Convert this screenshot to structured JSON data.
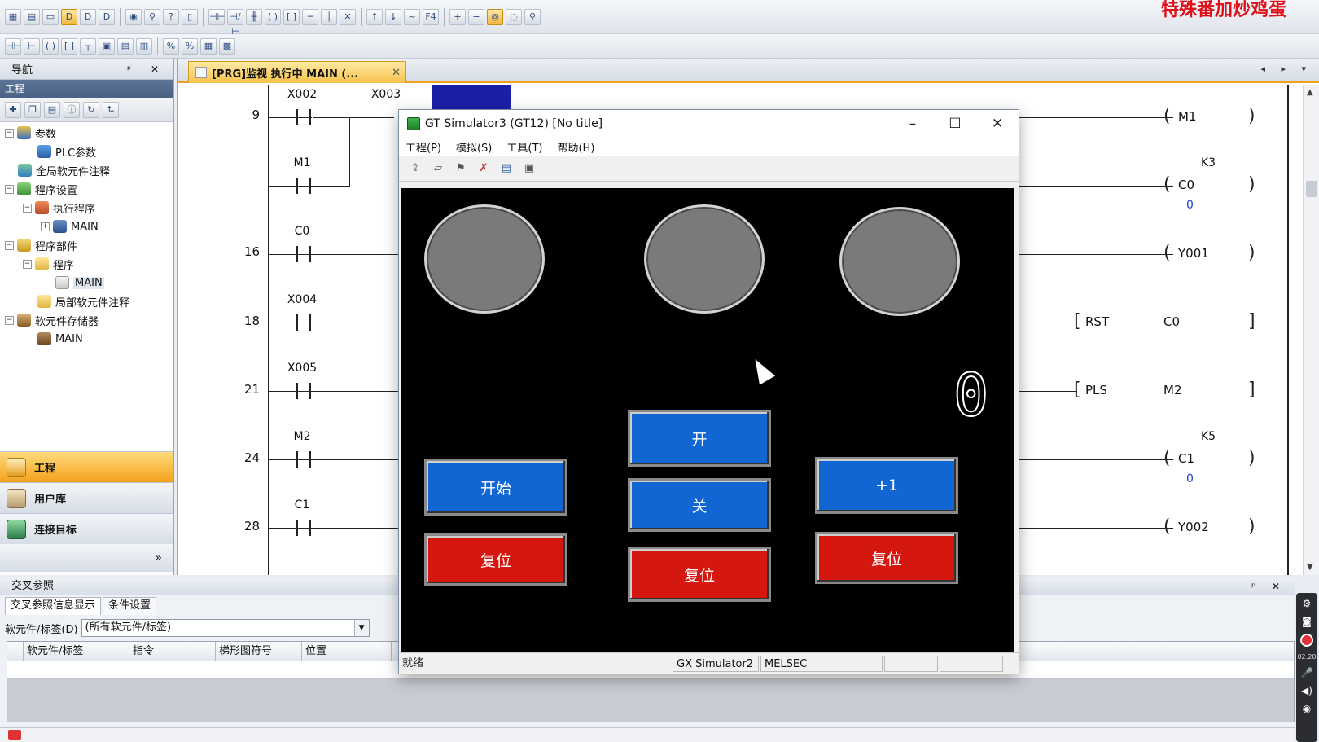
{
  "watermark": "特殊番加炒鸡蛋",
  "toolbar": {
    "row1_icons": [
      "project-icon",
      "save-icon",
      "window-icon",
      "device-monitor-icon",
      "device-write-icon",
      "device-read-icon",
      "monitor-icon",
      "search-icon",
      "help-icon",
      "find-icon"
    ],
    "row2_icons": [
      "ladder-icon",
      "contact-icon",
      "coil-icon",
      "function-icon"
    ]
  },
  "nav": {
    "title": "导航",
    "pin": "ᵖ ✕",
    "section": "工程",
    "tree": [
      {
        "label": "参数",
        "level": 0,
        "toggle": "−"
      },
      {
        "label": "PLC参数",
        "level": 1,
        "toggle": ""
      },
      {
        "label": "全局软元件注释",
        "level": 0,
        "toggle": ""
      },
      {
        "label": "程序设置",
        "level": 0,
        "toggle": "−"
      },
      {
        "label": "执行程序",
        "level": 1,
        "toggle": "−"
      },
      {
        "label": "MAIN",
        "level": 2,
        "toggle": "+"
      },
      {
        "label": "程序部件",
        "level": 0,
        "toggle": "−"
      },
      {
        "label": "程序",
        "level": 1,
        "toggle": "−"
      },
      {
        "label": "MAIN",
        "level": 2,
        "toggle": ""
      },
      {
        "label": "局部软元件注释",
        "level": 1,
        "toggle": ""
      },
      {
        "label": "软元件存储器",
        "level": 0,
        "toggle": "−"
      },
      {
        "label": "MAIN",
        "level": 1,
        "toggle": ""
      }
    ],
    "bottom": {
      "project": "工程",
      "library": "用户库",
      "connection": "连接目标",
      "more": "»"
    }
  },
  "editor": {
    "tab_label": "[PRG]监视 执行中 MAIN (...",
    "tab_close": "✕",
    "tab_nav": "◂ ▸ ▾",
    "rungs": [
      {
        "step": "9",
        "contact1": "X002",
        "contact2": "X003",
        "coil": "M1"
      },
      {
        "step": "",
        "contact1": "M1",
        "k": "K3",
        "coil": "C0",
        "value": "0"
      },
      {
        "step": "16",
        "contact1": "C0",
        "coil": "Y001"
      },
      {
        "step": "18",
        "contact1": "X004",
        "instr": "RST",
        "operand": "C0"
      },
      {
        "step": "21",
        "contact1": "X005",
        "instr": "PLS",
        "operand": "M2"
      },
      {
        "step": "24",
        "contact1": "M2",
        "k": "K5",
        "coil": "C1",
        "value": "0"
      },
      {
        "step": "28",
        "contact1": "C1",
        "coil": "Y002"
      }
    ]
  },
  "xref": {
    "title": "交叉参照",
    "ctrls": "ᵖ ✕",
    "tabs": [
      "交叉参照信息显示",
      "条件设置"
    ],
    "filter_label": "软元件/标签(D)",
    "filter_value": "(所有软元件/标签)",
    "columns": [
      "软元件/标签",
      "指令",
      "梯形图符号",
      "位置"
    ]
  },
  "recorder": {
    "time": "02:20"
  },
  "gt_window": {
    "title": "GT Simulator3 (GT12)  [No title]",
    "menu": [
      "工程(P)",
      "模拟(S)",
      "工具(T)",
      "帮助(H)"
    ],
    "min": "–",
    "max": "☐",
    "close": "✕",
    "buttons": {
      "start": "开始",
      "reset1": "复位",
      "on": "开",
      "off": "关",
      "reset2": "复位",
      "plus1": "+1",
      "reset3": "复位"
    },
    "counter_value": "0",
    "status": {
      "ready": "就绪",
      "sim": "GX Simulator2",
      "maker": "MELSEC"
    },
    "colors": {
      "button_blue": "#1266d4",
      "button_red": "#d41810",
      "lamp_off": "#7a7a7a"
    }
  }
}
